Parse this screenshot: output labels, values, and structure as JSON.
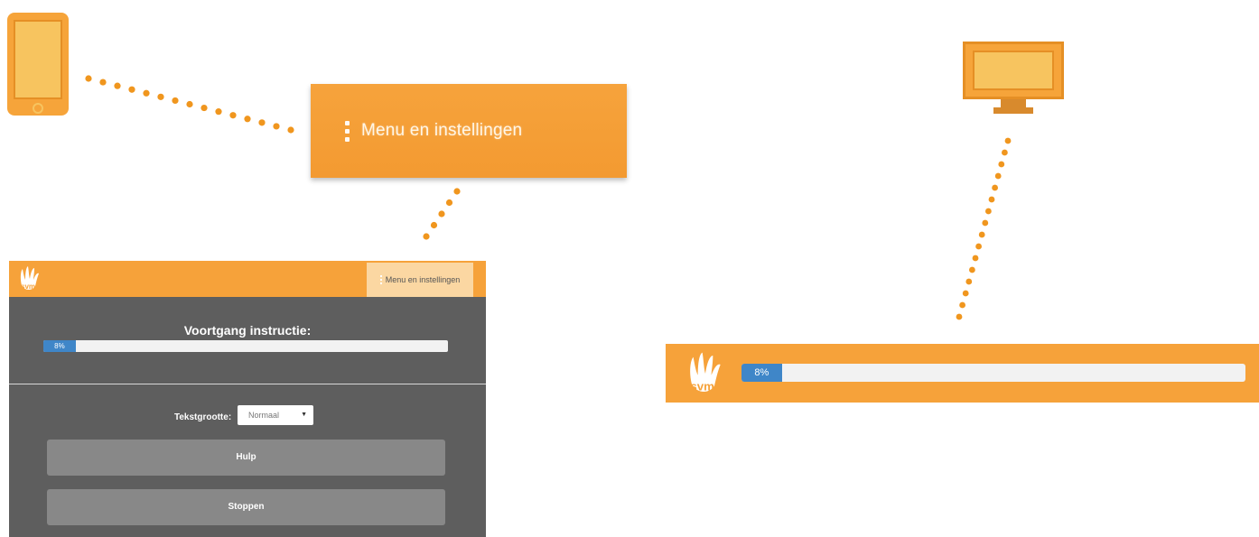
{
  "colors": {
    "orange": "#f6a23a",
    "dots": "#f0961e",
    "progress_blue": "#3f86c8",
    "panel_dark": "#5e5e5e",
    "button_gray": "#888888"
  },
  "icons": {
    "phone": "smartphone-icon",
    "monitor": "desktop-monitor-icon",
    "menu": "kebab-menu-icon",
    "logo": "svm-hand-logo",
    "caret": "caret-down-icon"
  },
  "zoom_menu": {
    "label": "Menu en instellingen"
  },
  "mobile": {
    "menu_label": "Menu en instellingen",
    "progress_title": "Voortgang instructie:",
    "progress_value": 0.08,
    "progress_label": "8%",
    "text_size_label": "Tekstgrootte:",
    "text_size_value": "Normaal",
    "help_label": "Hulp",
    "stop_label": "Stoppen"
  },
  "desktop": {
    "progress_value": 0.08,
    "progress_label": "8%"
  }
}
